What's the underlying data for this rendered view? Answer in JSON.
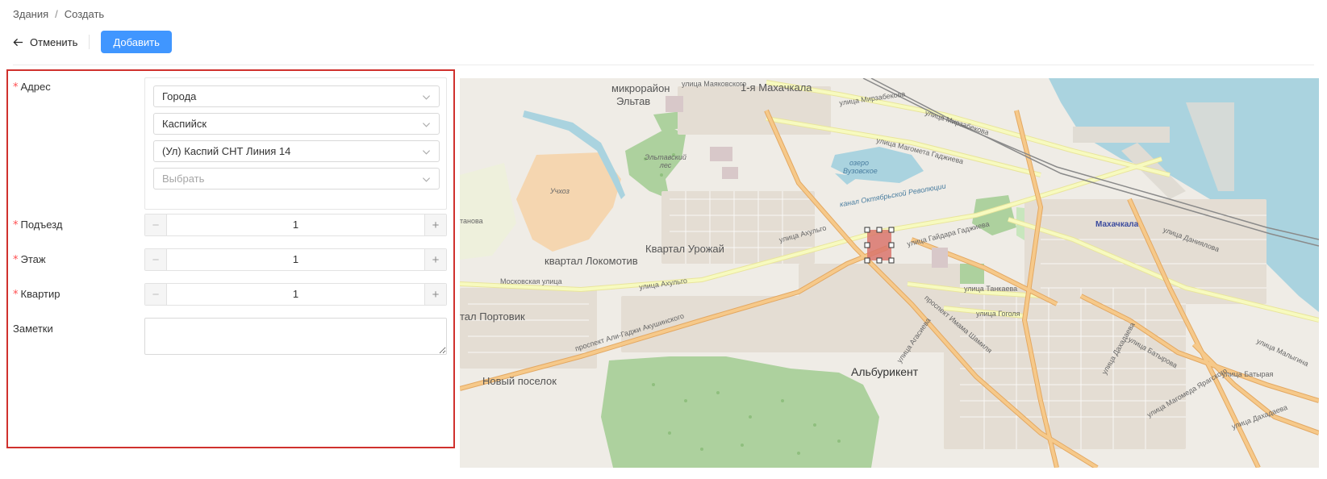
{
  "breadcrumb": {
    "items": [
      "Здания",
      "Создать"
    ],
    "separator": "/"
  },
  "toolbar": {
    "cancel_label": "Отменить",
    "submit_label": "Добавить"
  },
  "form": {
    "address": {
      "label": "Адрес",
      "selects": [
        {
          "value": "Города",
          "placeholder": false
        },
        {
          "value": "Каспийск",
          "placeholder": false
        },
        {
          "value": "(Ул) Каспий СНТ Линия 14",
          "placeholder": false
        },
        {
          "value": "Выбрать",
          "placeholder": true
        }
      ]
    },
    "entrance": {
      "label": "Подъезд",
      "value": "1",
      "minus": "−",
      "plus": "+"
    },
    "floor": {
      "label": "Этаж",
      "value": "1",
      "minus": "−",
      "plus": "+"
    },
    "apartment": {
      "label": "Квартир",
      "value": "1",
      "minus": "−",
      "plus": "+"
    },
    "notes": {
      "label": "Заметки",
      "value": ""
    },
    "required_mark": "*"
  },
  "map": {
    "labels": {
      "district_eltav_1": "микрорайон",
      "district_eltav_2": "Эльтав",
      "mayakovsky": "улица Маяковского",
      "makhachkala1": "1-я Махачкала",
      "mirzabekova1": "улица Мирзабекова",
      "mirzabekova2": "улица Мирзабекова",
      "eltavsky_les": "Эльтавский лес",
      "uchkhoz": "Учхоз",
      "gadzhieva": "улица Магомета Гаджиева",
      "ozero": "озеро Вузовское",
      "kanal": "канал Октябрьской Революции",
      "makhachkala_city": "Махачкала",
      "danialova": "улица Даниялова",
      "tanova": "танова",
      "akhulgo1": "улица Ахульго",
      "kvartal_urozhay": "Квартал Урожай",
      "lokomotiv": "квартал Локомотив",
      "gaydara": "улица Гайдара Гаджиева",
      "moskovskaya": "Московская улица",
      "akhulgo2": "улица Ахульго",
      "akushinsky": "проспект Али-Гаджи Акушинского",
      "tankaeva": "улица Танкаева",
      "gogolya": "улица Гоголя",
      "portovik": "тал Портовик",
      "dakhadaeva": "улица Дахадаева",
      "shamilya": "проспект Имама Шамиля",
      "agasieva": "улица Агасиева",
      "albourikent": "Альбурикент",
      "noviy_poselok": "Новый поселок",
      "batyrova": "улица Батырова",
      "batyraya": "улица Батырая",
      "malygina": "улица Малыгина",
      "yaragskogo": "улица Магомеда Ярагского",
      "dakhadaeva2": "улица Дахадаева"
    },
    "colors": {
      "land": "#efece6",
      "sea": "#aad3df",
      "park": "#add19e",
      "farmland": "#f5d6b0",
      "major_road": "#f6c98a",
      "secondary_road": "#f7fabf",
      "selection": "#d9766c"
    }
  }
}
